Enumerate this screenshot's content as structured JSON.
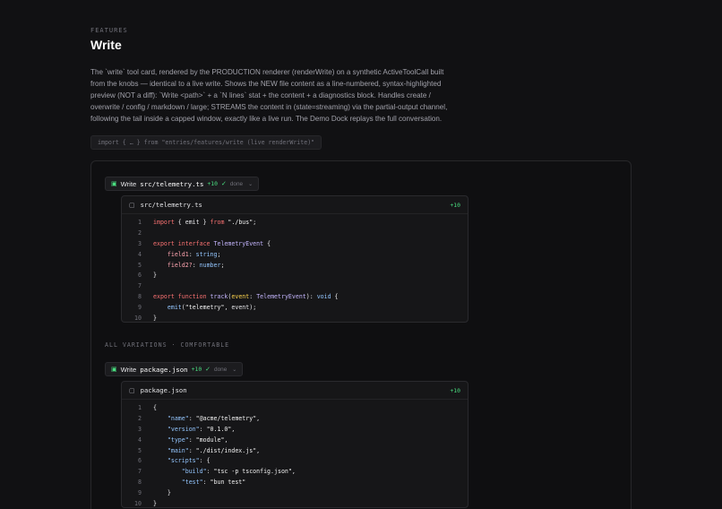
{
  "header": {
    "eyebrow": "FEATURES",
    "title": "Write",
    "description": "The `write` tool card, rendered by the PRODUCTION renderer (renderWrite) on a synthetic ActiveToolCall built from the knobs — identical to a live write. Shows the NEW file content as a line-numbered, syntax-highlighted preview (NOT a diff): `Write <path>` + a `N lines` stat + the content + a diagnostics block. Handles create / overwrite / config / markdown / large; STREAMS the content in (state=streaming) via the partial-output channel, following the tail inside a capped window, exactly like a live run. The Demo Dock replays the full conversation.",
    "import_line": "import { … } from \"entries/features/write (live renderWrite)\""
  },
  "primary": {
    "verb": "Write",
    "path": "src/telemetry.ts",
    "stat": "+10",
    "status": "done",
    "card_filename": "src/telemetry.ts",
    "card_stat": "+10"
  },
  "variations": {
    "label": "ALL VARIATIONS · COMFORTABLE",
    "verb": "Write",
    "path": "package.json",
    "stat": "+10",
    "status": "done",
    "card_filename": "package.json",
    "card_stat": "+10"
  },
  "icons": {
    "file": "file-icon",
    "doc": "document-icon",
    "check": "check-icon",
    "chevron": "chevron-down-icon"
  },
  "colors": {
    "background": "#111113",
    "accent_green": "#4ade80",
    "keyword": "#f87171",
    "type": "#c4b5fd"
  }
}
